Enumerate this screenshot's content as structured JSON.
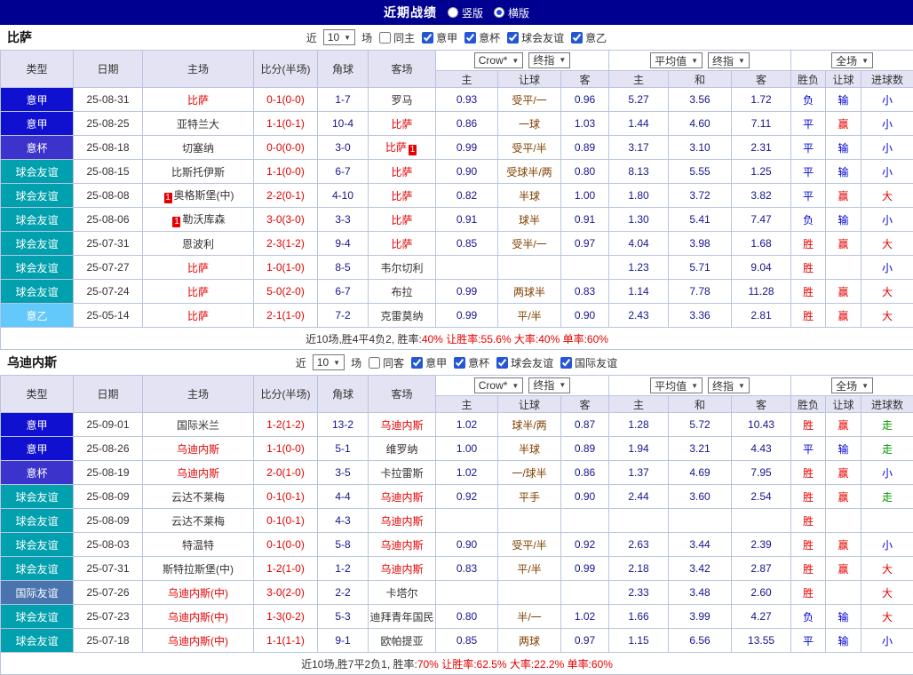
{
  "topbar": {
    "title": "近期战绩",
    "radios": [
      {
        "label": "竖版",
        "selected": false
      },
      {
        "label": "横版",
        "selected": true
      }
    ]
  },
  "colors": {
    "red": "#e60000",
    "blue": "#0000d6",
    "green": "#009900",
    "topbar_bg": "#000090",
    "header_bg": "#e3e3f3",
    "border": "#b9c4e0"
  },
  "league_colors": {
    "意甲": "#1010d0",
    "意杯": "#3b33cc",
    "球会友谊": "#00a0ae",
    "意乙": "#63c8fa",
    "国际友谊": "#4a74ae"
  },
  "sections": [
    {
      "team": "比萨",
      "filters": {
        "near": "近",
        "count": "10",
        "games": "场",
        "venue": {
          "label": "同主",
          "checked": false
        },
        "leagues": [
          {
            "label": "意甲",
            "checked": true
          },
          {
            "label": "意杯",
            "checked": true
          },
          {
            "label": "球会友谊",
            "checked": true
          },
          {
            "label": "意乙",
            "checked": true
          }
        ]
      },
      "header": {
        "left": [
          "类型",
          "日期",
          "主场",
          "比分(半场)",
          "角球",
          "客场"
        ],
        "groups": [
          {
            "selects": [
              "Crow*",
              "终指"
            ]
          },
          {
            "selects": [
              "平均值",
              "终指"
            ]
          },
          {
            "selects": [
              "全场"
            ]
          }
        ],
        "sub": [
          "主",
          "让球",
          "客",
          "主",
          "和",
          "客",
          "胜负",
          "让球",
          "进球数"
        ]
      },
      "rows": [
        {
          "t": "意甲",
          "d": "25-08-31",
          "h": "比萨",
          "hhl": true,
          "hcd": "",
          "s": "0-1(0-0)",
          "c": "1-7",
          "a": "罗马",
          "ahl": false,
          "acd": "",
          "o1": "0.93",
          "hc": "受平/一",
          "o2": "0.96",
          "a1": "5.27",
          "a2": "3.56",
          "a3": "1.72",
          "r1": "负",
          "r1c": "blue",
          "r2": "输",
          "r2c": "blue",
          "r3": "小",
          "r3c": "blue"
        },
        {
          "t": "意甲",
          "d": "25-08-25",
          "h": "亚特兰大",
          "hhl": false,
          "hcd": "",
          "s": "1-1(0-1)",
          "c": "10-4",
          "a": "比萨",
          "ahl": true,
          "acd": "",
          "o1": "0.86",
          "hc": "一球",
          "o2": "1.03",
          "a1": "1.44",
          "a2": "4.60",
          "a3": "7.11",
          "r1": "平",
          "r1c": "blue",
          "r2": "赢",
          "r2c": "red",
          "r3": "小",
          "r3c": "blue"
        },
        {
          "t": "意杯",
          "d": "25-08-18",
          "h": "切塞纳",
          "hhl": false,
          "hcd": "",
          "s": "0-0(0-0)",
          "c": "3-0",
          "a": "比萨",
          "ahl": true,
          "acd": "1",
          "o1": "0.99",
          "hc": "受平/半",
          "o2": "0.89",
          "a1": "3.17",
          "a2": "3.10",
          "a3": "2.31",
          "r1": "平",
          "r1c": "blue",
          "r2": "输",
          "r2c": "blue",
          "r3": "小",
          "r3c": "blue"
        },
        {
          "t": "球会友谊",
          "d": "25-08-15",
          "h": "比斯托伊斯",
          "hhl": false,
          "hcd": "",
          "s": "1-1(0-0)",
          "c": "6-7",
          "a": "比萨",
          "ahl": true,
          "acd": "",
          "o1": "0.90",
          "hc": "受球半/两",
          "o2": "0.80",
          "a1": "8.13",
          "a2": "5.55",
          "a3": "1.25",
          "r1": "平",
          "r1c": "blue",
          "r2": "输",
          "r2c": "blue",
          "r3": "小",
          "r3c": "blue"
        },
        {
          "t": "球会友谊",
          "d": "25-08-08",
          "h": "奥格斯堡(中)",
          "hhl": false,
          "hcd": "1",
          "s": "2-2(0-1)",
          "c": "4-10",
          "a": "比萨",
          "ahl": true,
          "acd": "",
          "o1": "0.82",
          "hc": "半球",
          "o2": "1.00",
          "a1": "1.80",
          "a2": "3.72",
          "a3": "3.82",
          "r1": "平",
          "r1c": "blue",
          "r2": "赢",
          "r2c": "red",
          "r3": "大",
          "r3c": "red"
        },
        {
          "t": "球会友谊",
          "d": "25-08-06",
          "h": "勒沃库森",
          "hhl": false,
          "hcd": "1",
          "s": "3-0(3-0)",
          "c": "3-3",
          "a": "比萨",
          "ahl": true,
          "acd": "",
          "o1": "0.91",
          "hc": "球半",
          "o2": "0.91",
          "a1": "1.30",
          "a2": "5.41",
          "a3": "7.47",
          "r1": "负",
          "r1c": "blue",
          "r2": "输",
          "r2c": "blue",
          "r3": "小",
          "r3c": "blue"
        },
        {
          "t": "球会友谊",
          "d": "25-07-31",
          "h": "恩波利",
          "hhl": false,
          "hcd": "",
          "s": "2-3(1-2)",
          "c": "9-4",
          "a": "比萨",
          "ahl": true,
          "acd": "",
          "o1": "0.85",
          "hc": "受半/一",
          "o2": "0.97",
          "a1": "4.04",
          "a2": "3.98",
          "a3": "1.68",
          "r1": "胜",
          "r1c": "red",
          "r2": "赢",
          "r2c": "red",
          "r3": "大",
          "r3c": "red"
        },
        {
          "t": "球会友谊",
          "d": "25-07-27",
          "h": "比萨",
          "hhl": true,
          "hcd": "",
          "s": "1-0(1-0)",
          "c": "8-5",
          "a": "韦尔切利",
          "ahl": false,
          "acd": "",
          "o1": "",
          "hc": "",
          "o2": "",
          "a1": "1.23",
          "a2": "5.71",
          "a3": "9.04",
          "r1": "胜",
          "r1c": "red",
          "r2": "",
          "r2c": "",
          "r3": "小",
          "r3c": "blue"
        },
        {
          "t": "球会友谊",
          "d": "25-07-24",
          "h": "比萨",
          "hhl": true,
          "hcd": "",
          "s": "5-0(2-0)",
          "c": "6-7",
          "a": "布拉",
          "ahl": false,
          "acd": "",
          "o1": "0.99",
          "hc": "两球半",
          "o2": "0.83",
          "a1": "1.14",
          "a2": "7.78",
          "a3": "11.28",
          "r1": "胜",
          "r1c": "red",
          "r2": "赢",
          "r2c": "red",
          "r3": "大",
          "r3c": "red"
        },
        {
          "t": "意乙",
          "d": "25-05-14",
          "h": "比萨",
          "hhl": true,
          "hcd": "",
          "s": "2-1(1-0)",
          "c": "7-2",
          "a": "克雷莫纳",
          "ahl": false,
          "acd": "",
          "o1": "0.99",
          "hc": "平/半",
          "o2": "0.90",
          "a1": "2.43",
          "a2": "3.36",
          "a3": "2.81",
          "r1": "胜",
          "r1c": "red",
          "r2": "赢",
          "r2c": "red",
          "r3": "大",
          "r3c": "red"
        }
      ],
      "summary": [
        {
          "t": "近10场,胜4平4负2, 胜率:",
          "c": ""
        },
        {
          "t": "40%",
          "c": "red"
        },
        {
          "t": " 让胜率:55.6%",
          "c": "red"
        },
        {
          "t": " 大率:40%",
          "c": "red"
        },
        {
          "t": " 单率:60%",
          "c": "red"
        }
      ]
    },
    {
      "team": "乌迪内斯",
      "filters": {
        "near": "近",
        "count": "10",
        "games": "场",
        "venue": {
          "label": "同客",
          "checked": false
        },
        "leagues": [
          {
            "label": "意甲",
            "checked": true
          },
          {
            "label": "意杯",
            "checked": true
          },
          {
            "label": "球会友谊",
            "checked": true
          },
          {
            "label": "国际友谊",
            "checked": true
          }
        ]
      },
      "header": {
        "left": [
          "类型",
          "日期",
          "主场",
          "比分(半场)",
          "角球",
          "客场"
        ],
        "groups": [
          {
            "selects": [
              "Crow*",
              "终指"
            ]
          },
          {
            "selects": [
              "平均值",
              "终指"
            ]
          },
          {
            "selects": [
              "全场"
            ]
          }
        ],
        "sub": [
          "主",
          "让球",
          "客",
          "主",
          "和",
          "客",
          "胜负",
          "让球",
          "进球数"
        ]
      },
      "rows": [
        {
          "t": "意甲",
          "d": "25-09-01",
          "h": "国际米兰",
          "hhl": false,
          "hcd": "",
          "s": "1-2(1-2)",
          "c": "13-2",
          "a": "乌迪内斯",
          "ahl": true,
          "acd": "",
          "o1": "1.02",
          "hc": "球半/两",
          "o2": "0.87",
          "a1": "1.28",
          "a2": "5.72",
          "a3": "10.43",
          "r1": "胜",
          "r1c": "red",
          "r2": "赢",
          "r2c": "red",
          "r3": "走",
          "r3c": "green"
        },
        {
          "t": "意甲",
          "d": "25-08-26",
          "h": "乌迪内斯",
          "hhl": true,
          "hcd": "",
          "s": "1-1(0-0)",
          "c": "5-1",
          "a": "维罗纳",
          "ahl": false,
          "acd": "",
          "o1": "1.00",
          "hc": "半球",
          "o2": "0.89",
          "a1": "1.94",
          "a2": "3.21",
          "a3": "4.43",
          "r1": "平",
          "r1c": "blue",
          "r2": "输",
          "r2c": "blue",
          "r3": "走",
          "r3c": "green"
        },
        {
          "t": "意杯",
          "d": "25-08-19",
          "h": "乌迪内斯",
          "hhl": true,
          "hcd": "",
          "s": "2-0(1-0)",
          "c": "3-5",
          "a": "卡拉雷斯",
          "ahl": false,
          "acd": "",
          "o1": "1.02",
          "hc": "一/球半",
          "o2": "0.86",
          "a1": "1.37",
          "a2": "4.69",
          "a3": "7.95",
          "r1": "胜",
          "r1c": "red",
          "r2": "赢",
          "r2c": "red",
          "r3": "小",
          "r3c": "blue"
        },
        {
          "t": "球会友谊",
          "d": "25-08-09",
          "h": "云达不莱梅",
          "hhl": false,
          "hcd": "",
          "s": "0-1(0-1)",
          "c": "4-4",
          "a": "乌迪内斯",
          "ahl": true,
          "acd": "",
          "o1": "0.92",
          "hc": "平手",
          "o2": "0.90",
          "a1": "2.44",
          "a2": "3.60",
          "a3": "2.54",
          "r1": "胜",
          "r1c": "red",
          "r2": "赢",
          "r2c": "red",
          "r3": "走",
          "r3c": "green"
        },
        {
          "t": "球会友谊",
          "d": "25-08-09",
          "h": "云达不莱梅",
          "hhl": false,
          "hcd": "",
          "s": "0-1(0-1)",
          "c": "4-3",
          "a": "乌迪内斯",
          "ahl": true,
          "acd": "",
          "o1": "",
          "hc": "",
          "o2": "",
          "a1": "",
          "a2": "",
          "a3": "",
          "r1": "胜",
          "r1c": "red",
          "r2": "",
          "r2c": "",
          "r3": "",
          "r3c": ""
        },
        {
          "t": "球会友谊",
          "d": "25-08-03",
          "h": "特温特",
          "hhl": false,
          "hcd": "",
          "s": "0-1(0-0)",
          "c": "5-8",
          "a": "乌迪内斯",
          "ahl": true,
          "acd": "",
          "o1": "0.90",
          "hc": "受平/半",
          "o2": "0.92",
          "a1": "2.63",
          "a2": "3.44",
          "a3": "2.39",
          "r1": "胜",
          "r1c": "red",
          "r2": "赢",
          "r2c": "red",
          "r3": "小",
          "r3c": "blue"
        },
        {
          "t": "球会友谊",
          "d": "25-07-31",
          "h": "斯特拉斯堡(中)",
          "hhl": false,
          "hcd": "",
          "s": "1-2(1-0)",
          "c": "1-2",
          "a": "乌迪内斯",
          "ahl": true,
          "acd": "",
          "o1": "0.83",
          "hc": "平/半",
          "o2": "0.99",
          "a1": "2.18",
          "a2": "3.42",
          "a3": "2.87",
          "r1": "胜",
          "r1c": "red",
          "r2": "赢",
          "r2c": "red",
          "r3": "大",
          "r3c": "red"
        },
        {
          "t": "国际友谊",
          "d": "25-07-26",
          "h": "乌迪内斯(中)",
          "hhl": true,
          "hcd": "",
          "s": "3-0(2-0)",
          "c": "2-2",
          "a": "卡塔尔",
          "ahl": false,
          "acd": "",
          "o1": "",
          "hc": "",
          "o2": "",
          "a1": "2.33",
          "a2": "3.48",
          "a3": "2.60",
          "r1": "胜",
          "r1c": "red",
          "r2": "",
          "r2c": "",
          "r3": "大",
          "r3c": "red"
        },
        {
          "t": "球会友谊",
          "d": "25-07-23",
          "h": "乌迪内斯(中)",
          "hhl": true,
          "hcd": "",
          "s": "1-3(0-2)",
          "c": "5-3",
          "a": "迪拜青年国民",
          "ahl": false,
          "acd": "",
          "o1": "0.80",
          "hc": "半/一",
          "o2": "1.02",
          "a1": "1.66",
          "a2": "3.99",
          "a3": "4.27",
          "r1": "负",
          "r1c": "blue",
          "r2": "输",
          "r2c": "blue",
          "r3": "大",
          "r3c": "red"
        },
        {
          "t": "球会友谊",
          "d": "25-07-18",
          "h": "乌迪内斯(中)",
          "hhl": true,
          "hcd": "",
          "s": "1-1(1-1)",
          "c": "9-1",
          "a": "欧帕提亚",
          "ahl": false,
          "acd": "",
          "o1": "0.85",
          "hc": "两球",
          "o2": "0.97",
          "a1": "1.15",
          "a2": "6.56",
          "a3": "13.55",
          "r1": "平",
          "r1c": "blue",
          "r2": "输",
          "r2c": "blue",
          "r3": "小",
          "r3c": "blue"
        }
      ],
      "summary": [
        {
          "t": "近10场,胜7平2负1, 胜率:",
          "c": ""
        },
        {
          "t": "70%",
          "c": "red"
        },
        {
          "t": " 让胜率:62.5%",
          "c": "red"
        },
        {
          "t": " 大率:22.2%",
          "c": "red"
        },
        {
          "t": " 单率:60%",
          "c": "red"
        }
      ]
    }
  ]
}
